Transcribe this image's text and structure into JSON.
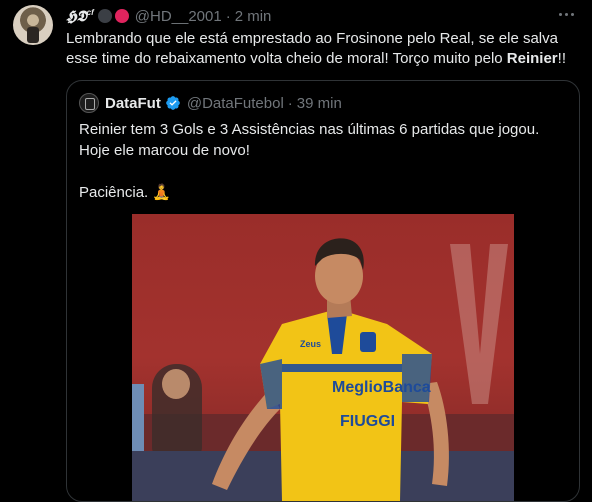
{
  "tweet": {
    "author_name": "𝕳𝕯",
    "author_sup": "cf",
    "handle": "@HD__2001",
    "separator": "·",
    "time": "2 min",
    "text_part1": "Lembrando que ele está emprestado ao Frosinone pelo Real, se ele salva esse time do rebaixamento volta cheio de moral! Torço muito pelo ",
    "text_bold": "Reinier",
    "text_end": "!!"
  },
  "quote": {
    "name": "DataFut",
    "handle": "@DataFutebol",
    "separator": "·",
    "time": "39 min",
    "line1": "Reinier tem 3 Gols e 3 Assistências nas últimas 6 partidas que jogou.",
    "line2": "Hoje ele marcou de novo!",
    "line3": "Paciência. 🧘",
    "photo": {
      "shirt_sponsor": "MeglioBanca",
      "shirt_brand": "Zeus",
      "shirt_back": "FIUGGI"
    }
  },
  "colors": {
    "background": "#000000",
    "text": "#e7e9ea",
    "muted": "#71767b",
    "verified": "#1d9bf0",
    "border": "#2f3336",
    "jersey": "#f2c416",
    "jersey_blue": "#1e4b9a"
  },
  "icons": {
    "more": "more-horizontal-icon",
    "verified": "verified-badge-icon"
  }
}
